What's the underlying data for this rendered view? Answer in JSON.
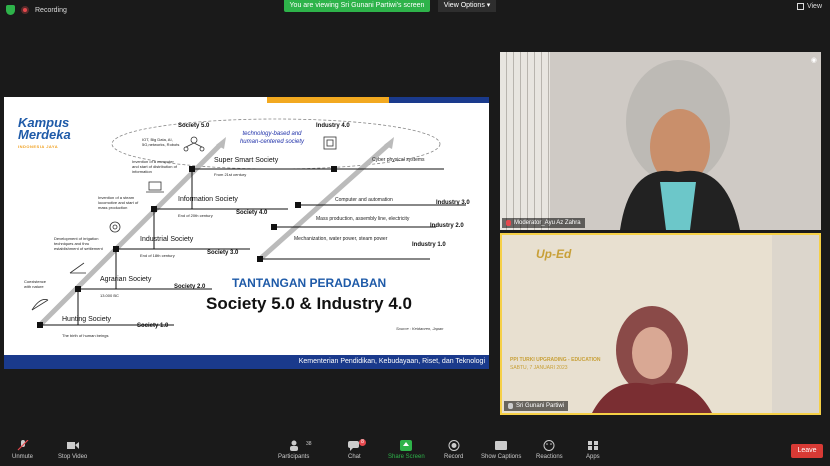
{
  "topbar": {
    "recording_label": "Recording",
    "banner": "You are viewing Sri Gunani Partiwi's screen",
    "view_options": "View Options",
    "view_label": "View"
  },
  "slide": {
    "logo_line1": "Kampus",
    "logo_line2": "Merdeka",
    "logo_sub": "INDONESIA JAYA",
    "society50": "Society 5.0",
    "industry40": "Industry 4.0",
    "cloud_text": "technology-based and human-centered society",
    "iot": "IOT, Big Data, AI, 5G,networks, Robots",
    "super_smart": "Super Smart Society",
    "from21": "From 21st century",
    "cyber": "Cyber physical systems",
    "invention_computer": "Invention of a computer and start of distribution of information",
    "information": "Information Society",
    "end20": "End of 20th century",
    "s40": "Society 4.0",
    "computer_auto": "Computer and automation",
    "i30": "Industry 3.0",
    "mass_prod": "Mass production, assembly line, electricity",
    "i20": "Industry 2.0",
    "invention_steam": "Invention of a steam locomotive and start of mass production",
    "industrial": "Industrial Society",
    "end18": "End of 18th century",
    "s30": "Society 3.0",
    "mechanization": "Mechanization, water power, steam power",
    "i10": "Industry 1.0",
    "irrigation": "Development of irrigation techniques and thru establishment of settlement",
    "agrarian": "Agrarian Society",
    "s20": "Society 2.0",
    "bc13000": "13.000 BC",
    "coexistence": "Coexistence with nature",
    "hunting": "Hunting Society",
    "s10": "Society 1.0",
    "birth": "The birth of human beings",
    "title1": "TANTANGAN PERADABAN",
    "title2": "Society 5.0 & Industry 4.0",
    "source": "Source : Keidanren, Japan",
    "footer": "Kementerian Pendidikan, Kebudayaan, Riset, dan Teknologi"
  },
  "videos": {
    "v1_name": "Moderator_Ayu Az Zahra",
    "v2_name": "Sri Gunani Partiwi",
    "v2_banner": "PPI TURKI UPGRADING - EDUCATION",
    "v2_date": "SABTU, 7 JANUARI 2023",
    "v2_logo": "Up-Ed"
  },
  "toolbar": {
    "unmute": "Unmute",
    "stop_video": "Stop Video",
    "participants": "Participants",
    "participants_count": "38",
    "chat": "Chat",
    "chat_badge": "8",
    "share": "Share Screen",
    "record": "Record",
    "captions": "Show Captions",
    "reactions": "Reactions",
    "apps": "Apps",
    "leave": "Leave"
  },
  "colors": {
    "green": "#2eb34a",
    "leave_red": "#d83a35",
    "slide_blue": "#1a3a8c",
    "slide_orange": "#f2a920"
  }
}
